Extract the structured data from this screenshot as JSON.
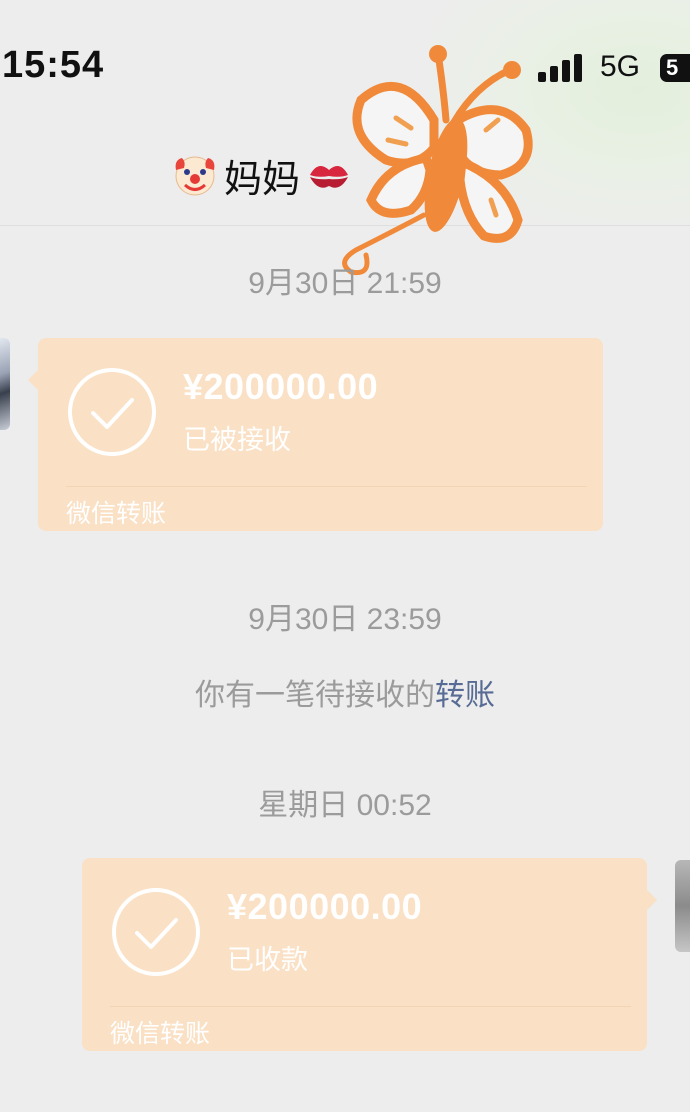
{
  "status_bar": {
    "time": "15:54",
    "network": "5G",
    "battery": "5"
  },
  "header": {
    "title": "妈妈"
  },
  "messages": {
    "ts1": "9月30日 21:59",
    "transfer1": {
      "amount": "¥200000.00",
      "status": "已被接收",
      "label": "微信转账"
    },
    "ts2": "9月30日 23:59",
    "system_prefix": "你有一笔待接收的",
    "system_link": "转账",
    "ts3": "星期日 00:52",
    "transfer2": {
      "amount": "¥200000.00",
      "status": "已收款",
      "label": "微信转账"
    }
  },
  "icons": {
    "clown": "clown-face-emoji",
    "kiss": "kiss-mark-emoji",
    "sticker": "butterfly-sticker",
    "check": "check-circle-icon"
  },
  "colors": {
    "background": "#ededed",
    "card": "#fae0c4",
    "link": "#576b95",
    "timestamp": "#9b9b9b"
  }
}
